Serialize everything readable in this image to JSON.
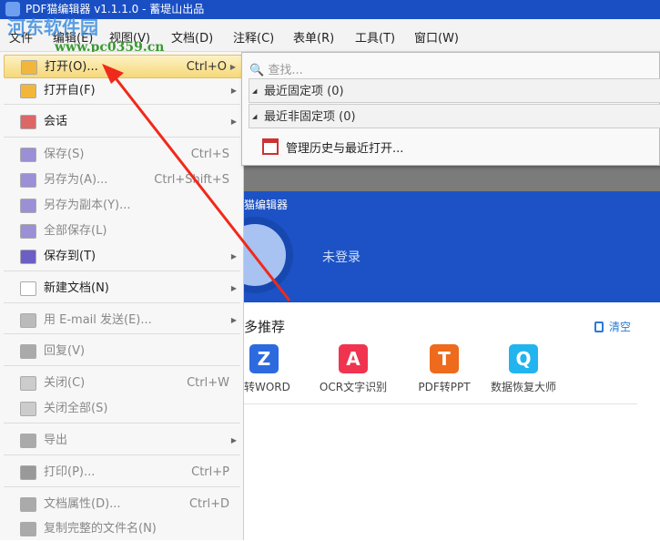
{
  "title": "PDF猫编辑器 v1.1.1.0 - 蓄堤山出品",
  "watermark": {
    "name": "河东软件园",
    "url": "www.pc0359.cn"
  },
  "menubar": [
    "文件",
    "编辑(E)",
    "视图(V)",
    "文档(D)",
    "注释(C)",
    "表单(R)",
    "工具(T)",
    "窗口(W)"
  ],
  "file_menu": [
    {
      "label": "打开(O)...",
      "shortcut": "Ctrl+O",
      "submenu": true,
      "highlighted": true
    },
    {
      "label": "打开自(F)",
      "submenu": true
    },
    {
      "label": "会话",
      "submenu": true
    },
    {
      "label": "保存(S)",
      "shortcut": "Ctrl+S",
      "disabled": true
    },
    {
      "label": "另存为(A)...",
      "shortcut": "Ctrl+Shift+S",
      "disabled": true
    },
    {
      "label": "另存为副本(Y)...",
      "disabled": true
    },
    {
      "label": "全部保存(L)",
      "disabled": true
    },
    {
      "label": "保存到(T)",
      "submenu": true
    },
    {
      "label": "新建文档(N)",
      "submenu": true
    },
    {
      "label": "用 E-mail 发送(E)...",
      "submenu": true,
      "disabled": true
    },
    {
      "label": "回复(V)",
      "disabled": true
    },
    {
      "label": "关闭(C)",
      "shortcut": "Ctrl+W",
      "disabled": true
    },
    {
      "label": "关闭全部(S)",
      "disabled": true
    },
    {
      "label": "导出",
      "submenu": true,
      "disabled": true
    },
    {
      "label": "打印(P)...",
      "shortcut": "Ctrl+P",
      "disabled": true
    },
    {
      "label": "文档属性(D)...",
      "shortcut": "Ctrl+D",
      "disabled": true
    },
    {
      "label": "复制完整的文件名(N)",
      "disabled": true
    }
  ],
  "submenu": {
    "search_placeholder": "查找...",
    "pinned": "最近固定项 (0)",
    "unpinned": "最近非固定项 (0)",
    "manage": "管理历史与最近打开..."
  },
  "banner": {
    "app": "猫编辑器",
    "login": "未登录"
  },
  "recommend": {
    "title": "多推荐",
    "clear": "清空",
    "tools": [
      {
        "label": "F转WORD",
        "color": "#2d6ae0",
        "glyph": "Z"
      },
      {
        "label": "OCR文字识别",
        "color": "#f0344f",
        "glyph": "A"
      },
      {
        "label": "PDF转PPT",
        "color": "#ee6a1c",
        "glyph": "T"
      },
      {
        "label": "数据恢复大师",
        "color": "#22b4ee",
        "glyph": "Q"
      }
    ]
  }
}
